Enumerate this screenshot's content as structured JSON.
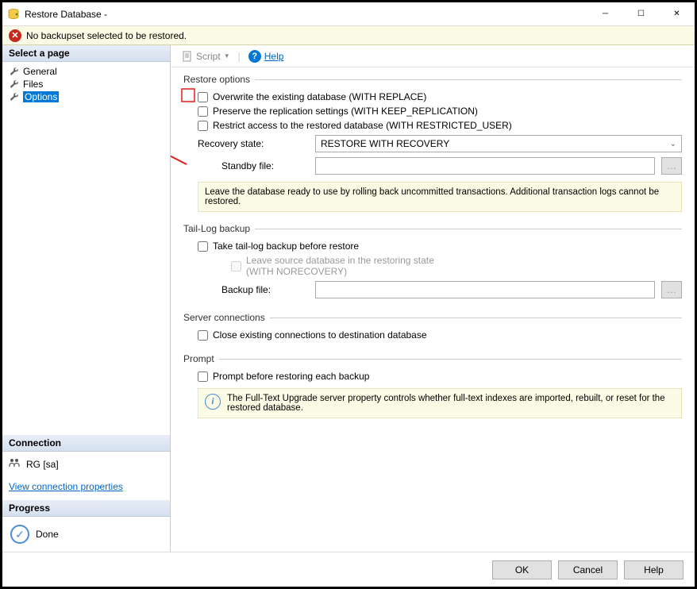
{
  "window": {
    "title": "Restore Database -"
  },
  "error_bar": {
    "message": "No backupset selected to be restored."
  },
  "sidebar": {
    "select_page_header": "Select a page",
    "pages": [
      {
        "label": "General"
      },
      {
        "label": "Files"
      },
      {
        "label": "Options"
      }
    ],
    "connection_header": "Connection",
    "connection_value": "RG [sa]",
    "view_conn_link": "View connection properties",
    "progress_header": "Progress",
    "progress_status": "Done"
  },
  "toolbar": {
    "script_label": "Script",
    "help_label": "Help"
  },
  "main": {
    "restore_options": {
      "legend": "Restore options",
      "overwrite_label": "Overwrite the existing database (WITH REPLACE)",
      "preserve_label": "Preserve the replication settings (WITH KEEP_REPLICATION)",
      "restrict_label": "Restrict access to the restored database (WITH RESTRICTED_USER)",
      "recovery_state_label": "Recovery state:",
      "recovery_state_value": "RESTORE WITH RECOVERY",
      "standby_label": "Standby file:",
      "info_text": "Leave the database ready to use by rolling back uncommitted transactions. Additional transaction logs cannot be restored."
    },
    "tail_log": {
      "legend": "Tail-Log backup",
      "take_label": "Take tail-log backup before restore",
      "leave_label": "Leave source database in the restoring state\n(WITH NORECOVERY)",
      "backup_file_label": "Backup file:"
    },
    "server_conn": {
      "legend": "Server connections",
      "close_label": "Close existing connections to destination database"
    },
    "prompt": {
      "legend": "Prompt",
      "prompt_label": "Prompt before restoring each backup",
      "info_text": "The Full-Text Upgrade server property controls whether full-text indexes are imported, rebuilt, or reset for the restored database."
    }
  },
  "footer": {
    "ok": "OK",
    "cancel": "Cancel",
    "help": "Help"
  }
}
